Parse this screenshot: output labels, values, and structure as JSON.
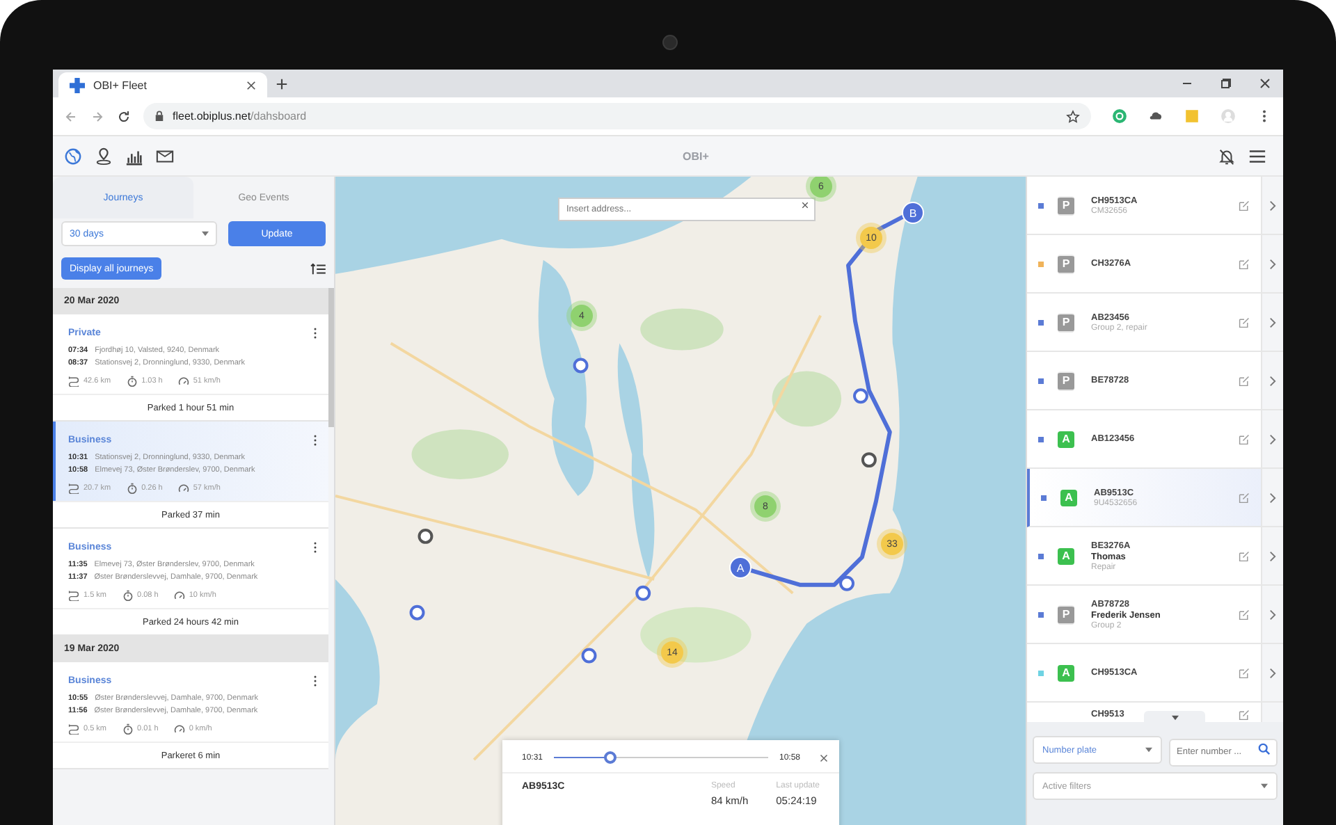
{
  "browser": {
    "tab_title": "OBI+ Fleet",
    "url_host": "fleet.obiplus.net",
    "url_path": "/dahsboard"
  },
  "app_header": {
    "nav": [
      {
        "selected": true
      },
      {
        "selected": false
      },
      {
        "selected": false
      },
      {
        "selected": false
      }
    ],
    "logo": "OBI+"
  },
  "left_panel": {
    "tabs": [
      {
        "label": "Journeys",
        "selected": true
      },
      {
        "label": "Geo Events",
        "selected": false
      }
    ],
    "period_select": "30 days",
    "update_button": "Update",
    "display_all_button": "Display all journeys",
    "days": [
      {
        "date": "20 Mar 2020",
        "journeys": [
          {
            "type": "Private",
            "selected": false,
            "stops": [
              {
                "time": "07:34",
                "address": "Fjordhøj 10, Valsted, 9240, Denmark"
              },
              {
                "time": "08:37",
                "address": "Stationsvej 2, Dronninglund, 9330, Denmark"
              }
            ],
            "distance": "42.6 km",
            "duration": "1.03 h",
            "speed": "51 km/h",
            "parked": "Parked 1 hour 51 min"
          },
          {
            "type": "Business",
            "selected": true,
            "stops": [
              {
                "time": "10:31",
                "address": "Stationsvej 2, Dronninglund, 9330, Denmark"
              },
              {
                "time": "10:58",
                "address": "Elmevej 73, Øster Brønderslev, 9700, Denmark"
              }
            ],
            "distance": "20.7 km",
            "duration": "0.26 h",
            "speed": "57 km/h",
            "parked": "Parked 37 min"
          },
          {
            "type": "Business",
            "selected": false,
            "stops": [
              {
                "time": "11:35",
                "address": "Elmevej 73, Øster Brønderslev, 9700, Denmark"
              },
              {
                "time": "11:37",
                "address": "Øster Brønderslevvej, Damhale, 9700, Denmark"
              }
            ],
            "distance": "1.5 km",
            "duration": "0.08 h",
            "speed": "10 km/h",
            "parked": "Parked 24 hours  42 min"
          }
        ]
      },
      {
        "date": "19 Mar 2020",
        "journeys": [
          {
            "type": "Business",
            "selected": false,
            "stops": [
              {
                "time": "10:55",
                "address": "Øster Brønderslevvej, Damhale, 9700, Denmark"
              },
              {
                "time": "11:56",
                "address": "Øster Brønderslevvej, Damhale, 9700, Denmark"
              }
            ],
            "distance": "0.5 km",
            "duration": "0.01 h",
            "speed": "0 km/h",
            "parked": "Parkeret 6 min"
          }
        ]
      }
    ]
  },
  "map": {
    "search_placeholder": "Insert address...",
    "clusters": [
      {
        "count": "6",
        "color": "#8fd16f"
      },
      {
        "count": "10",
        "color": "#f3c94b"
      },
      {
        "count": "4",
        "color": "#8fd16f"
      },
      {
        "count": "8",
        "color": "#8fd16f"
      },
      {
        "count": "33",
        "color": "#f3c94b"
      },
      {
        "count": "14",
        "color": "#f3c94b"
      }
    ],
    "route_markers": [
      "A",
      "B"
    ],
    "trip_panel": {
      "start_time": "10:31",
      "end_time": "10:58",
      "level": 0.26,
      "plate": "AB9513C",
      "speed_label": "Speed",
      "speed": "84 km/h",
      "update_label": "Last update",
      "update": "05:24:19"
    }
  },
  "vehicles": [
    {
      "plate": "CH9513CA",
      "sub": "CM32656",
      "kind": "parked",
      "letter": "P",
      "color": "#5b7bd5",
      "selected": false
    },
    {
      "plate": "CH3276A",
      "kind": "parked",
      "letter": "P",
      "color": "#f0b35a",
      "selected": false
    },
    {
      "plate": "AB23456",
      "sub": "Group 2, repair",
      "kind": "parked",
      "letter": "P",
      "color": "#5b7bd5",
      "selected": false
    },
    {
      "plate": "BE78728",
      "kind": "parked",
      "letter": "P",
      "color": "#5b7bd5",
      "selected": false
    },
    {
      "plate": "AB123456",
      "kind": "active",
      "letter": "A",
      "color": "#5b7bd5",
      "selected": false
    },
    {
      "plate": "AB9513C",
      "sub": "9U4532656",
      "kind": "active",
      "letter": "A",
      "color": "#5b7bd5",
      "selected": true
    },
    {
      "plate": "BE3276A",
      "name": "Thomas",
      "sub": "Repair",
      "kind": "active",
      "letter": "A",
      "color": "#5b7bd5",
      "selected": false
    },
    {
      "plate": "AB78728",
      "name": "Frederik Jensen",
      "sub": "Group 2",
      "kind": "parked",
      "letter": "P",
      "color": "#5b7bd5",
      "selected": false
    },
    {
      "plate": "CH9513CA",
      "kind": "active",
      "letter": "A",
      "color": "#6fd3e3",
      "selected": false
    },
    {
      "plate": "CH9513",
      "kind": "hidden",
      "selected": false
    }
  ],
  "filters": {
    "field_select": "Number plate",
    "search_placeholder": "Enter number ...",
    "active_filters": "Active filters"
  }
}
